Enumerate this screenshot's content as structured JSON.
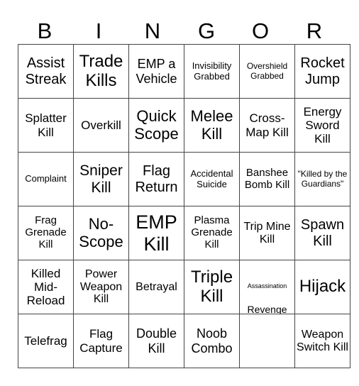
{
  "header": {
    "letters": [
      "B",
      "I",
      "N",
      "G",
      "O",
      "R"
    ]
  },
  "grid": {
    "rows": [
      [
        "Assist Streak",
        "Trade Kills",
        "EMP a Vehicle",
        "Invisibility Grabbed",
        "Overshield Grabbed",
        "Rocket Jump"
      ],
      [
        "Splatter Kill",
        "Overkill",
        "Quick Scope",
        "Melee Kill",
        "Cross-Map Kill",
        "Energy Sword Kill"
      ],
      [
        "Complaint",
        "Sniper Kill",
        "Flag Return",
        "Accidental Suicide",
        "Banshee Bomb Kill",
        "\"Killed by the Guardians\""
      ],
      [
        "Frag Grenade Kill",
        "No-Scope",
        "EMP Kill",
        "Plasma Grenade Kill",
        "Trip Mine Kill",
        "Spawn Kill"
      ],
      [
        "Killed Mid-Reload",
        "Power Weapon Kill",
        "Betrayal",
        "Triple Kill",
        "Assassination",
        "Hijack"
      ],
      [
        "Telefrag",
        "Flag Capture",
        "Double Kill",
        "Noob Combo",
        "Revenge",
        "Weapon Switch Kill"
      ]
    ]
  }
}
